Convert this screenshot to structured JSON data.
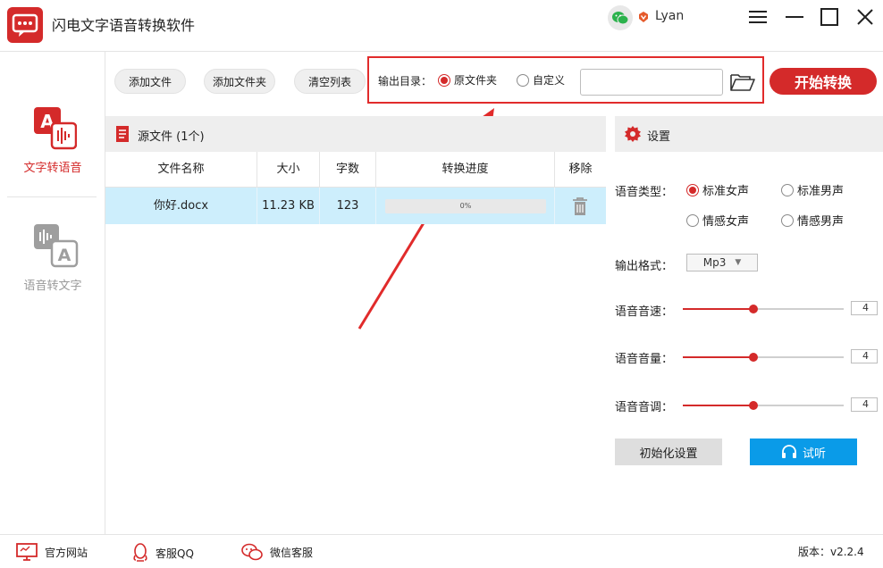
{
  "app": {
    "title": "闪电文字语音转换软件"
  },
  "user": {
    "name": "Lyan"
  },
  "sidebar": {
    "items": [
      {
        "label": "文字转语音",
        "active": true
      },
      {
        "label": "语音转文字",
        "active": false
      }
    ]
  },
  "toolbar": {
    "add_file": "添加文件",
    "add_folder": "添加文件夹",
    "clear_list": "清空列表",
    "output_label": "输出目录：",
    "option_source": "原文件夹",
    "option_custom": "自定义",
    "path_value": "",
    "start_button": "开始转换"
  },
  "source_panel": {
    "title": "源文件 (1个)",
    "columns": [
      "文件名称",
      "大小",
      "字数",
      "转换进度",
      "移除"
    ],
    "rows": [
      {
        "name": "你好.docx",
        "size": "11.23 KB",
        "words": "123",
        "progress_text": "0%",
        "progress": 0
      }
    ]
  },
  "settings": {
    "title": "设置",
    "voice_type_label": "语音类型：",
    "voice_options": [
      "标准女声",
      "标准男声",
      "情感女声",
      "情感男声"
    ],
    "voice_selected": "标准女声",
    "format_label": "输出格式：",
    "format_value": "Mp3",
    "speed_label": "语音音速：",
    "speed_value": "4",
    "volume_label": "语音音量：",
    "volume_value": "4",
    "pitch_label": "语音音调：",
    "pitch_value": "4",
    "slider_fraction": 0.44,
    "reset_button": "初始化设置",
    "listen_button": "试听"
  },
  "footer": {
    "website": "官方网站",
    "qq_service": "客服QQ",
    "wechat_service": "微信客服",
    "version": "版本：v2.2.4"
  },
  "colors": {
    "accent": "#d42a2a",
    "blue_button": "#0a9be8",
    "selected_row": "#cdeefc"
  }
}
